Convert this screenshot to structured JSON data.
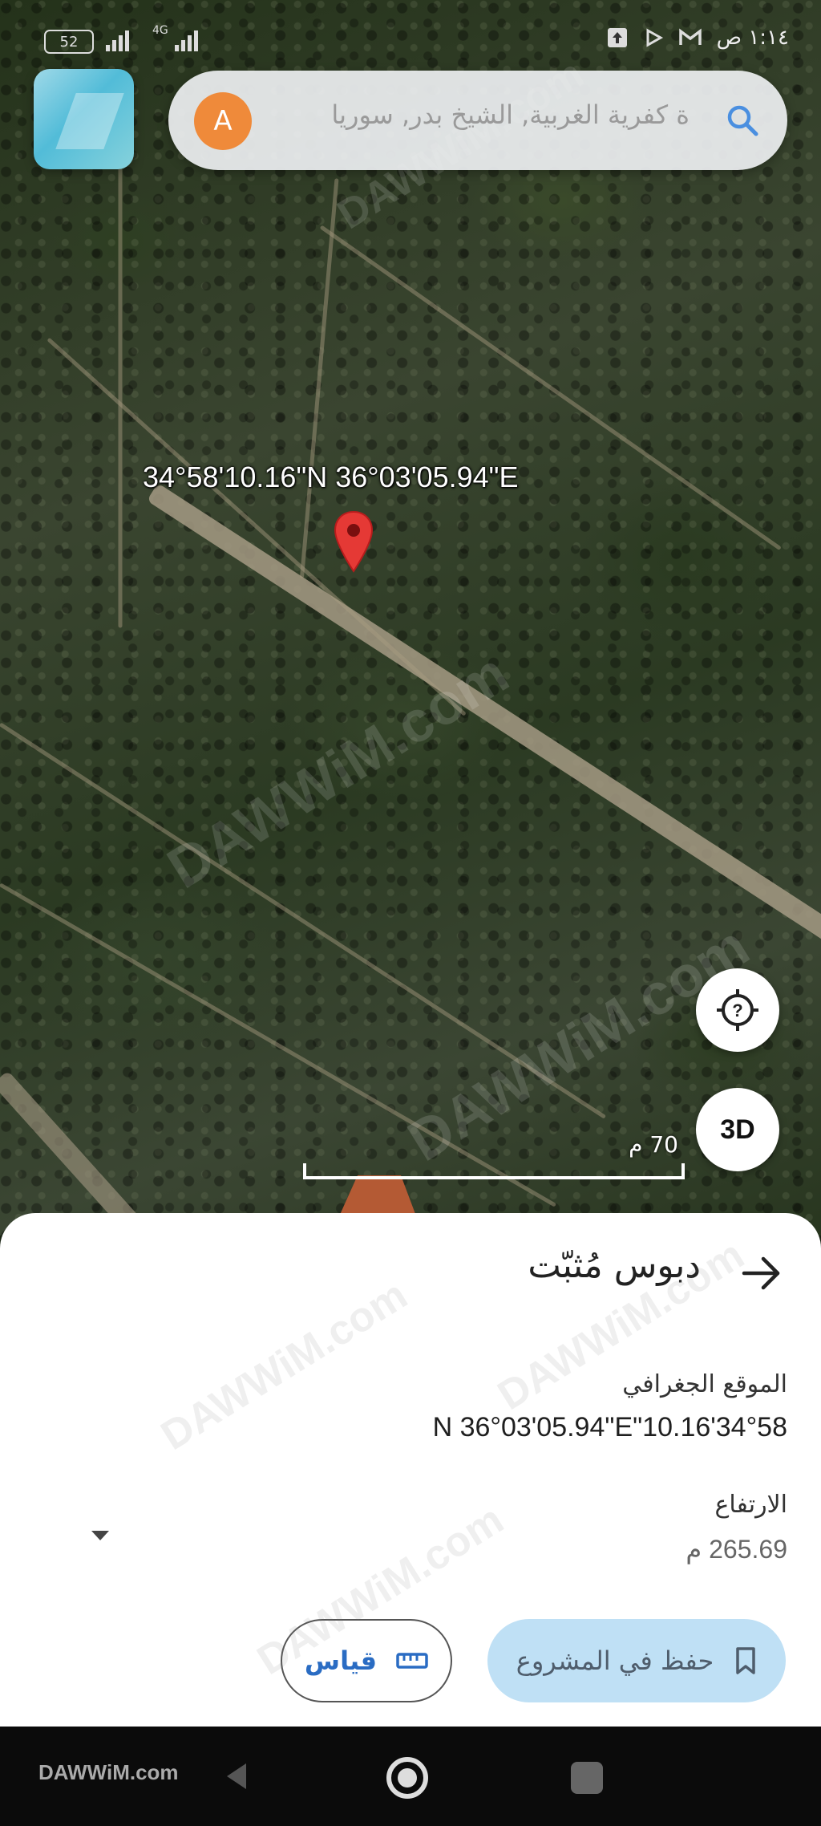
{
  "status_bar": {
    "battery": "52",
    "network": "4G",
    "time": "١:١٤ ص"
  },
  "search": {
    "avatar_letter": "A",
    "query": "ة كفرية الغربية, الشيخ بدر, سوريا"
  },
  "map": {
    "pin_coordinates": "34°58'10.16\"N 36°03'05.94\"E",
    "scale_label": "70 م",
    "button_3d": "3D"
  },
  "sheet": {
    "title": "دبوس مُثبّت",
    "geo_label": "الموقع الجغرافي",
    "geo_value": "N 36°03'05.94\"E\"10.16'34°58",
    "altitude_label": "الارتفاع",
    "altitude_value": "265.69 م",
    "measure_button": "قياس",
    "save_button": "حفظ في المشروع"
  },
  "nav": {
    "brand": "DAWWiM.com"
  },
  "watermark": "DAWWiM.com",
  "colors": {
    "pin": "#e53935",
    "accent_blue": "#2a6cc3",
    "save_button_bg": "#bfe0f5",
    "avatar": "#ef8a3a"
  },
  "icons": [
    "search-icon",
    "back-arrow-icon",
    "help-location-icon",
    "ruler-icon",
    "bookmark-icon",
    "dropdown-icon",
    "map-pin-icon"
  ]
}
